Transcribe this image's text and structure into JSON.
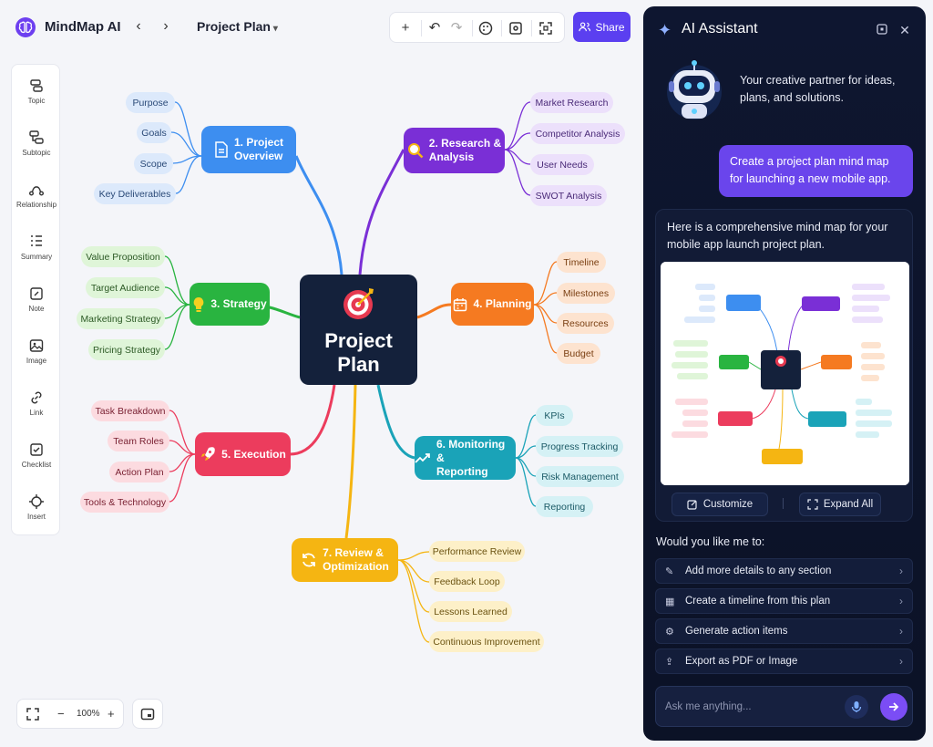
{
  "header": {
    "app_name": "MindMap AI",
    "doc_title": "Project Plan",
    "share_label": "Share"
  },
  "toolbar_icons": [
    "add-icon",
    "undo-icon",
    "redo-icon",
    "palette-icon",
    "focus-icon",
    "fit-icon"
  ],
  "tools": [
    {
      "label": "Topic",
      "icon": "topic-icon"
    },
    {
      "label": "Subtopic",
      "icon": "subtopic-icon"
    },
    {
      "label": "Relationship",
      "icon": "relationship-icon"
    },
    {
      "label": "Summary",
      "icon": "summary-icon"
    },
    {
      "label": "Note",
      "icon": "note-icon"
    },
    {
      "label": "Image",
      "icon": "image-icon"
    },
    {
      "label": "Link",
      "icon": "link-icon"
    },
    {
      "label": "Checklist",
      "icon": "checklist-icon"
    },
    {
      "label": "Insert",
      "icon": "insert-icon"
    }
  ],
  "mindmap": {
    "center": {
      "line1": "Project",
      "line2": "Plan"
    },
    "branches": [
      {
        "label1": "1. Project",
        "label2": "Overview",
        "color": "#3d8ef0",
        "leaf_bg": "#dce9fb",
        "leaf_fg": "#2b4a78",
        "leaves": [
          "Purpose",
          "Goals",
          "Scope",
          "Key Deliverables"
        ]
      },
      {
        "label1": "2. Research &",
        "label2": "Analysis",
        "color": "#7a2fd6",
        "leaf_bg": "#ece0fb",
        "leaf_fg": "#4a2a78",
        "leaves": [
          "Market Research",
          "Competitor Analysis",
          "User Needs",
          "SWOT Analysis"
        ]
      },
      {
        "label1": "3. Strategy",
        "label2": "",
        "color": "#29b440",
        "leaf_bg": "#dff5d8",
        "leaf_fg": "#2c5a25",
        "leaves": [
          "Value Proposition",
          "Target Audience",
          "Marketing Strategy",
          "Pricing Strategy"
        ]
      },
      {
        "label1": "4. Planning",
        "label2": "",
        "color": "#f57a21",
        "leaf_bg": "#fde3cf",
        "leaf_fg": "#7a3f12",
        "leaves": [
          "Timeline",
          "Milestones",
          "Resources",
          "Budget"
        ]
      },
      {
        "label1": "5. Execution",
        "label2": "",
        "color": "#ec3c5d",
        "leaf_bg": "#fcdbe0",
        "leaf_fg": "#7a2233",
        "leaves": [
          "Task Breakdown",
          "Team Roles",
          "Action Plan",
          "Tools & Technology"
        ]
      },
      {
        "label1": "6. Monitoring &",
        "label2": "Reporting",
        "color": "#1aa3b8",
        "leaf_bg": "#d5f1f5",
        "leaf_fg": "#1b5a66",
        "leaves": [
          "KPIs",
          "Progress Tracking",
          "Risk Management",
          "Reporting"
        ]
      },
      {
        "label1": "7. Review &",
        "label2": "Optimization",
        "color": "#f5b512",
        "leaf_bg": "#fdf0c8",
        "leaf_fg": "#6a5210",
        "leaves": [
          "Performance Review",
          "Feedback Loop",
          "Lessons Learned",
          "Continuous Improvement"
        ]
      }
    ]
  },
  "zoom": {
    "level": "100%"
  },
  "assistant": {
    "title": "AI Assistant",
    "intro": "Your creative partner for ideas, plans, and solutions.",
    "user_message": "Create a project plan mind map for launching a new mobile app.",
    "response": "Here is a comprehensive mind map for your mobile app launch project plan.",
    "customize_label": "Customize",
    "expand_label": "Expand All",
    "prompt": "Would you like me to:",
    "suggestions": [
      "Add more details to any section",
      "Create a timeline from this plan",
      "Generate action items",
      "Export as PDF or Image"
    ],
    "input_placeholder": "Ask me anything..."
  }
}
